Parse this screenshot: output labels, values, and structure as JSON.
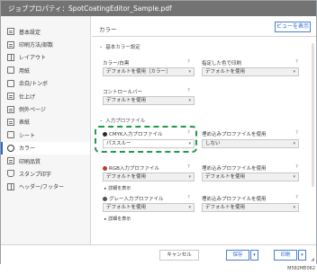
{
  "window": {
    "title": "ジョブプロパティ：SpotCoatingEditor_Sample.pdf"
  },
  "sidebar": {
    "items": [
      {
        "label": "基本設定",
        "icon": "basic-settings-icon"
      },
      {
        "label": "印刷方法/部数",
        "icon": "print-method-icon"
      },
      {
        "label": "レイアウト",
        "icon": "layout-icon"
      },
      {
        "label": "用紙",
        "icon": "paper-icon"
      },
      {
        "label": "余白/トンボ",
        "icon": "margin-icon"
      },
      {
        "label": "仕上げ",
        "icon": "finishing-icon"
      },
      {
        "label": "例外ページ",
        "icon": "exception-page-icon"
      },
      {
        "label": "表紙",
        "icon": "cover-icon"
      },
      {
        "label": "シート",
        "icon": "sheet-icon"
      },
      {
        "label": "カラー",
        "icon": "color-icon",
        "active": true
      },
      {
        "label": "印刷品質",
        "icon": "print-quality-icon"
      },
      {
        "label": "スタンプ印字",
        "icon": "stamp-icon"
      },
      {
        "label": "ヘッダー/フッター",
        "icon": "header-footer-icon"
      }
    ]
  },
  "main": {
    "header": "カラー",
    "preview_button": "ビューを表示",
    "basic_section": "基本カラー設定",
    "color_mode": {
      "label": "カラー/白黒",
      "value": "デフォルトを使用［カラー］"
    },
    "specified_color": {
      "label": "指定した色で印刷",
      "value": "デフォルトを使用"
    },
    "contrast": {
      "label": "コントロールバー",
      "value": "デフォルトを使用"
    },
    "input_section": "入力プロファイル",
    "cmyk": {
      "label": "CMYK入力プロファイル",
      "value": "パススルー",
      "embedded_label": "埋め込みプロファイルを使用",
      "embedded_value": "しない",
      "color": "#2b2b2b"
    },
    "rgb": {
      "label": "RGB入力プロファイル",
      "value": "デフォルトを使用",
      "embedded_label": "埋め込みプロファイルを使用",
      "embedded_value": "デフォルトを使用",
      "detail": "詳細を表示",
      "color": "#c0392b"
    },
    "gray": {
      "label": "グレー入力プロファイル",
      "value": "デフォルトを使用",
      "embedded_label": "埋め込みプロファイルを使用",
      "embedded_value": "デフォルトを使用",
      "detail": "詳細を表示",
      "color": "#555555"
    },
    "help_mark": "?"
  },
  "footer": {
    "cancel": "キャンセル",
    "save": "保存",
    "print": "印刷"
  },
  "figure_code": "M582ME062",
  "colors": {
    "accent": "#2a66c9",
    "highlight": "#1f9a4a",
    "titlebar": "#737373"
  }
}
